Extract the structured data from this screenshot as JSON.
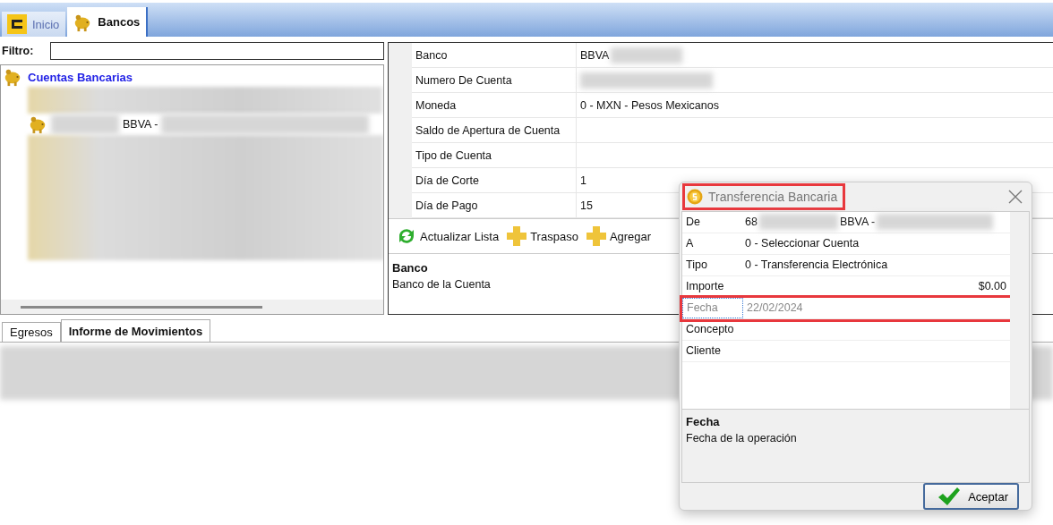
{
  "top_tabs": [
    {
      "label": "Inicio",
      "selected": false
    },
    {
      "label": "Bancos",
      "selected": true
    }
  ],
  "filter": {
    "label": "Filtro:"
  },
  "tree": {
    "root": "Cuentas Bancarias",
    "children": [
      {
        "label": "BBVA -"
      }
    ]
  },
  "properties": [
    {
      "label": "Banco",
      "value": "BBVA",
      "redacted": true
    },
    {
      "label": "Numero De Cuenta",
      "redacted": true
    },
    {
      "label": "Moneda",
      "value": "0 - MXN - Pesos Mexicanos",
      "redacted": false
    },
    {
      "label": "Saldo de Apertura de Cuenta",
      "redacted": false
    },
    {
      "label": "Tipo de Cuenta",
      "redacted": false
    },
    {
      "label": "Día de Corte",
      "value": "1",
      "redacted": false
    },
    {
      "label": "Día de Pago",
      "value": "15",
      "redacted": false
    }
  ],
  "toolbar": [
    {
      "label": "Actualizar Lista"
    },
    {
      "label": "Traspaso"
    },
    {
      "label": "Agregar"
    }
  ],
  "description": {
    "title": "Banco",
    "text": "Banco de la Cuenta"
  },
  "bottom_tabs": [
    {
      "label": "Egresos",
      "selected": false
    },
    {
      "label": "Informe de Movimientos",
      "selected": true
    }
  ],
  "dialog": {
    "title": "Transferencia Bancaria",
    "title_highlighted": true,
    "rows": [
      {
        "label": "De",
        "parts": [
          "68",
          "BBVA -"
        ],
        "redacted": true,
        "kind": "text",
        "selected": false,
        "highlighted": false
      },
      {
        "label": "A",
        "parts": [
          "0 - Seleccionar Cuenta"
        ],
        "redacted": false,
        "kind": "text",
        "selected": false,
        "highlighted": false
      },
      {
        "label": "Tipo",
        "parts": [
          "0 - Transferencia Electrónica"
        ],
        "redacted": false,
        "kind": "text",
        "selected": false,
        "highlighted": false
      },
      {
        "label": "Importe",
        "parts": [
          "$0.00"
        ],
        "redacted": false,
        "kind": "amount",
        "selected": false,
        "highlighted": false
      },
      {
        "label": "Fecha",
        "parts": [
          "22/02/2024"
        ],
        "redacted": false,
        "kind": "text",
        "selected": true,
        "highlighted": true
      },
      {
        "label": "Concepto",
        "redacted": false,
        "kind": "text",
        "selected": false,
        "highlighted": false
      },
      {
        "label": "Cliente",
        "redacted": false,
        "kind": "text",
        "selected": false,
        "highlighted": false
      }
    ],
    "description": {
      "title": "Fecha",
      "text": "Fecha de la operación"
    },
    "button": "Aceptar"
  }
}
